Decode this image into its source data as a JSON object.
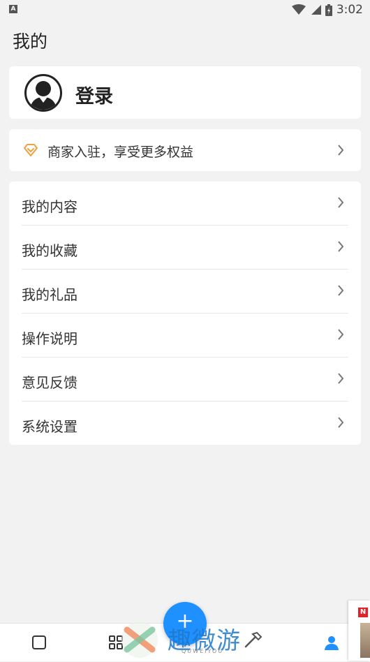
{
  "status_bar": {
    "left_badge": "A",
    "time": "3:02",
    "icons": [
      "wifi-icon",
      "signal-icon",
      "battery-charging-icon"
    ]
  },
  "header": {
    "title": "我的"
  },
  "login_card": {
    "avatar_icon": "user-avatar-icon",
    "label": "登录"
  },
  "merchant_banner": {
    "icon": "diamond-icon",
    "label": "商家入驻，享受更多权益",
    "accent": "#f0a040"
  },
  "menu": {
    "items": [
      {
        "label": "我的内容"
      },
      {
        "label": "我的收藏"
      },
      {
        "label": "我的礼品"
      },
      {
        "label": "操作说明"
      },
      {
        "label": "意见反馈"
      },
      {
        "label": "系统设置"
      }
    ]
  },
  "bottom_nav": {
    "items": [
      {
        "icon": "square-icon"
      },
      {
        "icon": "grid-icon"
      },
      {
        "icon": "profile-icon",
        "active": true
      }
    ],
    "fab_label": "+",
    "accent": "#1e90ff"
  },
  "watermark": {
    "text": "趣微游",
    "sub": "QUWEIYOU"
  },
  "corner_ad": {
    "logo_text": "N"
  }
}
